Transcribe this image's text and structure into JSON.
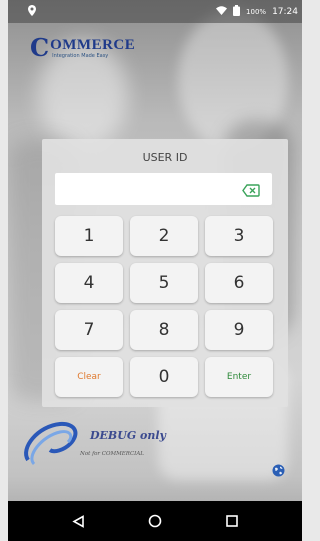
{
  "status_bar": {
    "battery_percent": "100%",
    "time": "17:24",
    "icons": [
      "location-pin-icon",
      "wifi-icon",
      "battery-icon"
    ]
  },
  "logo": {
    "initial": "C",
    "word": "OMMERCE",
    "tagline": "Integration Made Easy"
  },
  "login": {
    "title": "USER ID",
    "field_value": "",
    "backspace_icon": "backspace-icon"
  },
  "keypad": {
    "keys": [
      "1",
      "2",
      "3",
      "4",
      "5",
      "6",
      "7",
      "8",
      "9",
      "Clear",
      "0",
      "Enter"
    ],
    "clear_color": "#e07a2f",
    "enter_color": "#2f8a3b"
  },
  "footer": {
    "debug_label": "DEBUG only",
    "debug_sub": "Not for COMMERCIAL",
    "globe_icon": "globe-icon"
  },
  "nav_bar": {
    "icons": [
      "back-icon",
      "home-icon",
      "recents-icon"
    ]
  }
}
